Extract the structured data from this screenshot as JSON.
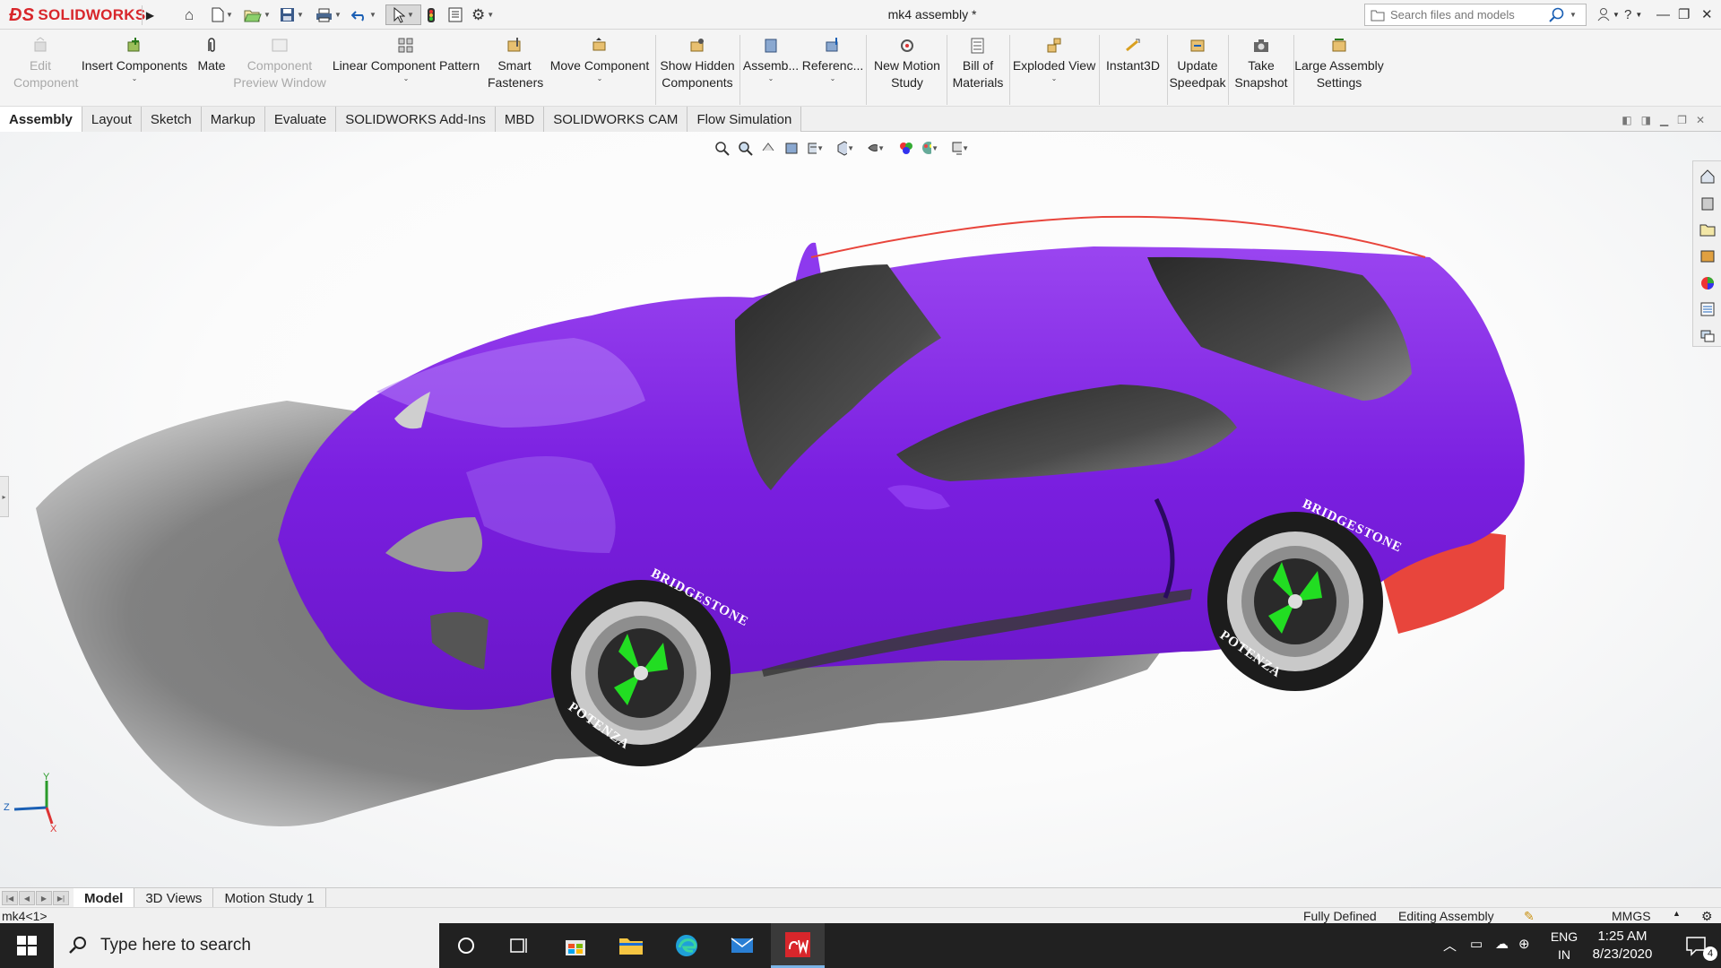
{
  "app": {
    "brand": "SOLIDWORKS",
    "document_title": "mk4 assembly *"
  },
  "search": {
    "placeholder": "Search files and models"
  },
  "command_manager": {
    "edit_component": "Edit Component",
    "insert_components": "Insert Components",
    "mate": "Mate",
    "component_preview": "Component Preview Window",
    "linear_pattern": "Linear Component Pattern",
    "smart_fasteners": "Smart Fasteners",
    "move_component": "Move Component",
    "show_hidden": "Show Hidden Components",
    "assembly": "Assemb...",
    "reference": "Referenc...",
    "new_motion": "New Motion Study",
    "bom": "Bill of Materials",
    "exploded": "Exploded View",
    "instant3d": "Instant3D",
    "speedpak": "Update Speedpak",
    "snapshot": "Take Snapshot",
    "large_assembly": "Large Assembly Settings"
  },
  "tabs": [
    "Assembly",
    "Layout",
    "Sketch",
    "Markup",
    "Evaluate",
    "SOLIDWORKS Add-Ins",
    "MBD",
    "SOLIDWORKS CAM",
    "Flow Simulation"
  ],
  "model_tabs": [
    "Model",
    "3D Views",
    "Motion Study 1"
  ],
  "statusbar": {
    "component": "mk4<1>",
    "defined": "Fully Defined",
    "mode": "Editing Assembly",
    "units": "MMGS"
  },
  "tires": {
    "brand": "BRIDGESTONE",
    "model": "POTENZA"
  },
  "triad": {
    "x": "X",
    "y": "Y",
    "z": "Z"
  },
  "taskbar": {
    "search_placeholder": "Type here to search",
    "lang_1": "ENG",
    "lang_2": "IN",
    "time": "1:25 AM",
    "date": "8/23/2020",
    "notifications": "4"
  },
  "colors": {
    "body": "#8a2be2",
    "body_dark": "#5a0fb0",
    "accent_red": "#e8453c",
    "rim_green": "#22dd22",
    "brand_red": "#d8262b"
  }
}
